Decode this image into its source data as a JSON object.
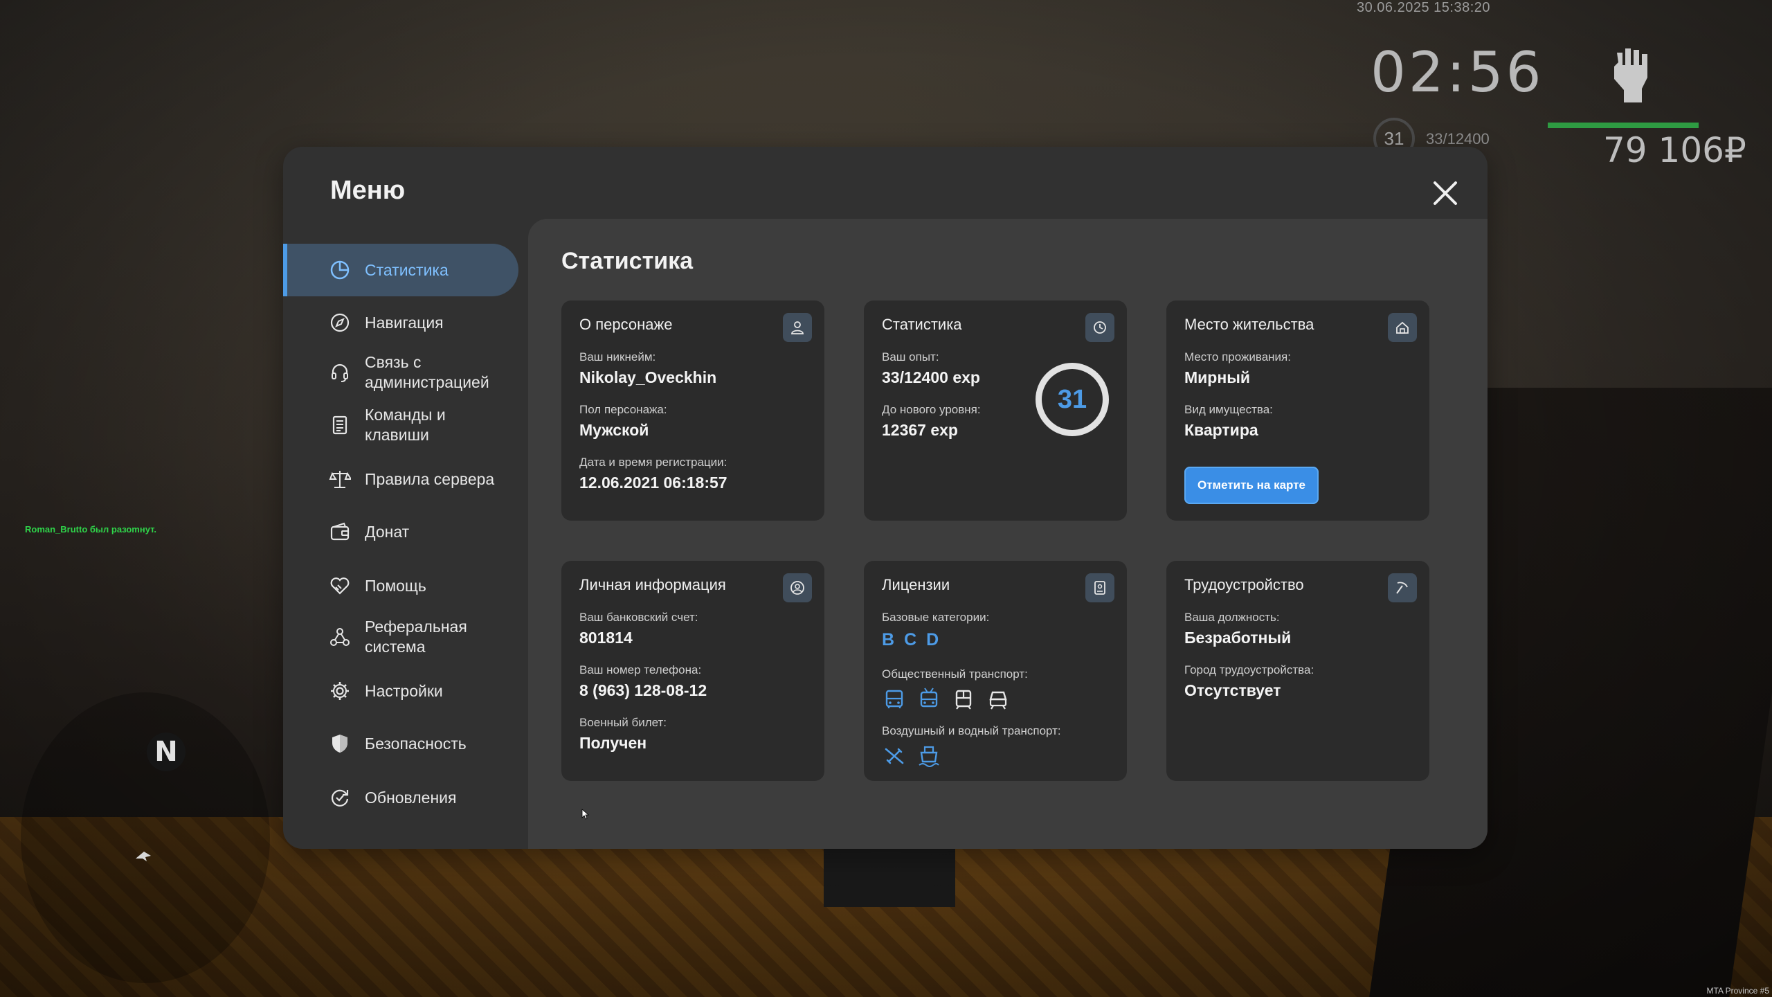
{
  "hud": {
    "datetime": "30.06.2025 15:38:20",
    "clock": "02:56",
    "level": "31",
    "exp": "33/12400",
    "money": "79 106₽",
    "health_fraction": 1.0,
    "chat_line": "Roman_Brutto был разоmнут.",
    "compass": "N",
    "watermark": "MTA Province #5",
    "colors": {
      "health": "#2e9b42",
      "chat": "#2fd44a"
    }
  },
  "menu": {
    "title": "Меню",
    "close_icon": "close-icon",
    "sidebar": {
      "items": [
        {
          "label": "Статистика",
          "icon": "pie-chart-icon",
          "active": true
        },
        {
          "label": "Навигация",
          "icon": "compass-icon",
          "active": false
        },
        {
          "label": "Связь с\nадминистрацией",
          "icon": "headset-icon",
          "active": false
        },
        {
          "label": "Команды и\nклавиши",
          "icon": "document-icon",
          "active": false
        },
        {
          "label": "Правила сервера",
          "icon": "scales-icon",
          "active": false
        },
        {
          "label": "Донат",
          "icon": "wallet-icon",
          "active": false
        },
        {
          "label": "Помощь",
          "icon": "handshake-heart-icon",
          "active": false
        },
        {
          "label": "Реферальная\nсистема",
          "icon": "network-icon",
          "active": false
        },
        {
          "label": "Настройки",
          "icon": "gear-icon",
          "active": false
        },
        {
          "label": "Безопасность",
          "icon": "shield-icon",
          "active": false
        },
        {
          "label": "Обновления",
          "icon": "refresh-check-icon",
          "active": false
        }
      ]
    },
    "content": {
      "title": "Статистика",
      "about": {
        "title": "О персонаже",
        "icon": "user-icon",
        "nickname_label": "Ваш никнейм:",
        "nickname": "Nikolay_Oveckhin",
        "gender_label": "Пол персонажа:",
        "gender": "Мужской",
        "reg_label": "Дата и время регистрации:",
        "reg_date": "12.06.2021 06:18:57"
      },
      "stats": {
        "title": "Статистика",
        "icon": "clock-icon",
        "exp_label": "Ваш опыт:",
        "exp": "33/12400 exp",
        "next_label": "До нового уровня:",
        "next": "12367 exp",
        "level": "31"
      },
      "residence": {
        "title": "Место жительства",
        "icon": "house-icon",
        "place_label": "Место проживания:",
        "place": "Мирный",
        "property_label": "Вид имущества:",
        "property": "Квартира",
        "map_button": "Отметить на карте"
      },
      "personal": {
        "title": "Личная информация",
        "icon": "user-circle-icon",
        "bank_label": "Ваш банковский счет:",
        "bank": "801814",
        "phone_label": "Ваш номер телефона:",
        "phone": "8 (963) 128-08-12",
        "military_label": "Военный билет:",
        "military": "Получен"
      },
      "licenses": {
        "title": "Лицензии",
        "icon": "id-card-icon",
        "base_label": "Базовые категории:",
        "categories": [
          "B",
          "C",
          "D"
        ],
        "public_label": "Общественный транспорт:",
        "public_icons": [
          "bus-icon",
          "trolleybus-icon",
          "tram-icon",
          "train-icon"
        ],
        "air_label": "Воздушный и водный транспорт:",
        "air_icons": [
          "plane-icon",
          "ship-icon"
        ]
      },
      "job": {
        "title": "Трудоустройство",
        "icon": "pickaxe-icon",
        "position_label": "Ваша должность:",
        "position": "Безработный",
        "city_label": "Город трудоустройства:",
        "city": "Отсутствует"
      }
    },
    "colors": {
      "accent": "#4d9be6",
      "active_bg": "#3f5266",
      "button": "#3a8ee6"
    }
  }
}
